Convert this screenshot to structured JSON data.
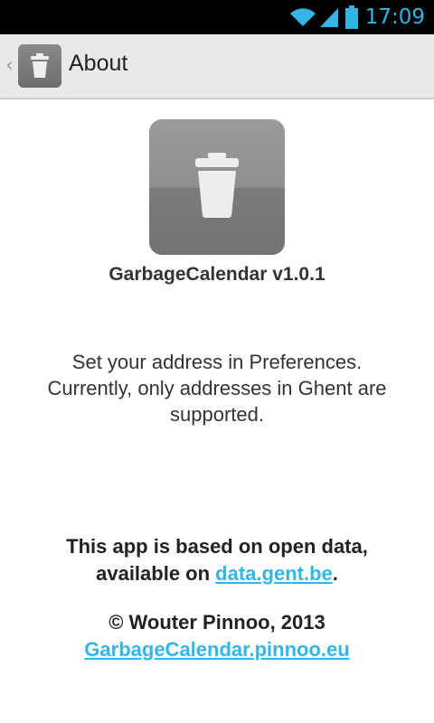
{
  "status_bar": {
    "time": "17:09",
    "accent_color": "#33b5e5",
    "icons": [
      "wifi-icon",
      "signal-icon",
      "battery-icon"
    ]
  },
  "action_bar": {
    "title": "About",
    "up_icon": "chevron-left-icon",
    "app_icon": "trash-can-icon"
  },
  "about": {
    "version": "GarbageCalendar v1.0.1",
    "info_line_1": "Set your address in Preferences.",
    "info_line_2": "Currently, only addresses in Ghent are supported.",
    "data_line_1": "This app is based on open data,",
    "data_prefix": "available on ",
    "data_link": "data.gent.be",
    "data_suffix": ".",
    "copyright": "© Wouter Pinnoo, 2013",
    "website_link": "GarbageCalendar.pinnoo.eu",
    "link_color": "#33b5e5"
  }
}
